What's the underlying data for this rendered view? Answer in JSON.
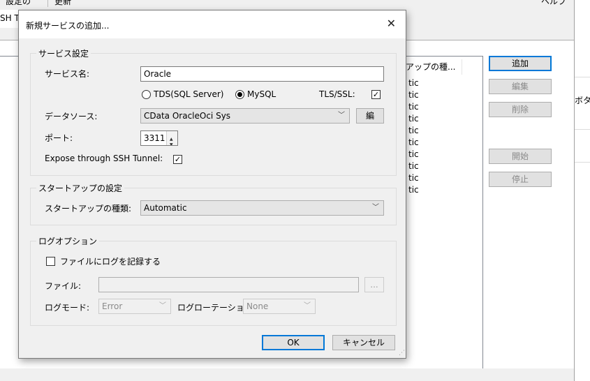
{
  "background": {
    "toolbar_fragment": "設定の",
    "toolbar_fragment2": "更新",
    "help_fragment": "ヘルプ",
    "tab_fragment": "SH T",
    "column_header": "アップの種...",
    "rows": [
      "tic",
      "tic",
      "tic",
      "tic",
      "tic",
      "tic",
      "tic",
      "tic",
      "tic",
      "tic"
    ],
    "buttons": {
      "add": "追加",
      "edit": "編集",
      "delete": "削除",
      "start": "開始",
      "stop": "停止"
    },
    "right_fragment": "ボタ"
  },
  "dialog": {
    "title": "新規サービスの追加...",
    "close_glyph": "✕",
    "service_settings": {
      "legend": "サービス設定",
      "service_name_label": "サービス名:",
      "service_name_value": "Oracle",
      "protocol_tds_label": "TDS(SQL Server)",
      "protocol_mysql_label": "MySQL",
      "selected_protocol": "MySQL",
      "tls_label": "TLS/SSL:",
      "tls_checked": true,
      "datasource_label": "データソース:",
      "datasource_value": "CData OracleOci Sys",
      "edit_button": "編",
      "port_label": "ポート:",
      "port_value": "3311",
      "ssh_tunnel_label": "Expose through SSH Tunnel:",
      "ssh_tunnel_checked": true
    },
    "startup_settings": {
      "legend": "スタートアップの設定",
      "startup_type_label": "スタートアップの種類:",
      "startup_type_value": "Automatic"
    },
    "log_options": {
      "legend": "ログオプション",
      "log_to_file_label": "ファイルにログを記録する",
      "log_to_file_checked": false,
      "file_label": "ファイル:",
      "file_value": "",
      "browse_button": "...",
      "log_mode_label": "ログモード:",
      "log_mode_value": "Error",
      "log_rotation_label": "ログローテーショ",
      "log_rotation_value": "None"
    },
    "ok_button": "OK",
    "cancel_button": "キャンセル"
  },
  "colors": {
    "accent": "#0078d7",
    "dialog_bg": "#f0f0f0",
    "field_border": "#7a7a7a"
  }
}
